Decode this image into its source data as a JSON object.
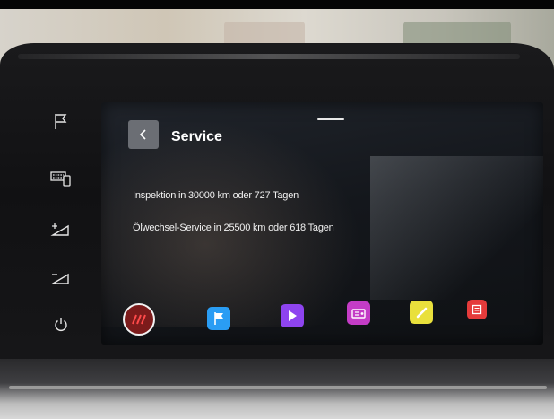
{
  "header": {
    "title": "Service"
  },
  "service": {
    "inspection": "Inspektion in 30000 km oder 727 Tagen",
    "oil_change": "Ölwechsel-Service in 25500 km oder 618 Tagen"
  },
  "side_keys": [
    "flag-icon",
    "keyboard-phone-icon",
    "brightness-up-icon",
    "brightness-down-icon",
    "power-icon"
  ],
  "dock": {
    "home_icon": "stripes-icon",
    "apps": [
      {
        "name": "navigation-flag-icon",
        "color": "#2a9df4"
      },
      {
        "name": "media-play-icon",
        "color": "#8e44ef"
      },
      {
        "name": "radio-icon",
        "color": "#c43cc6"
      },
      {
        "name": "phone-icon",
        "color": "#e9e03c"
      },
      {
        "name": "apps-icon",
        "color": "#e53b3b"
      }
    ]
  },
  "colors": {
    "screen_background": "#15181d",
    "back_button": "#6b6e74",
    "home_button": "#7c1b1b"
  }
}
